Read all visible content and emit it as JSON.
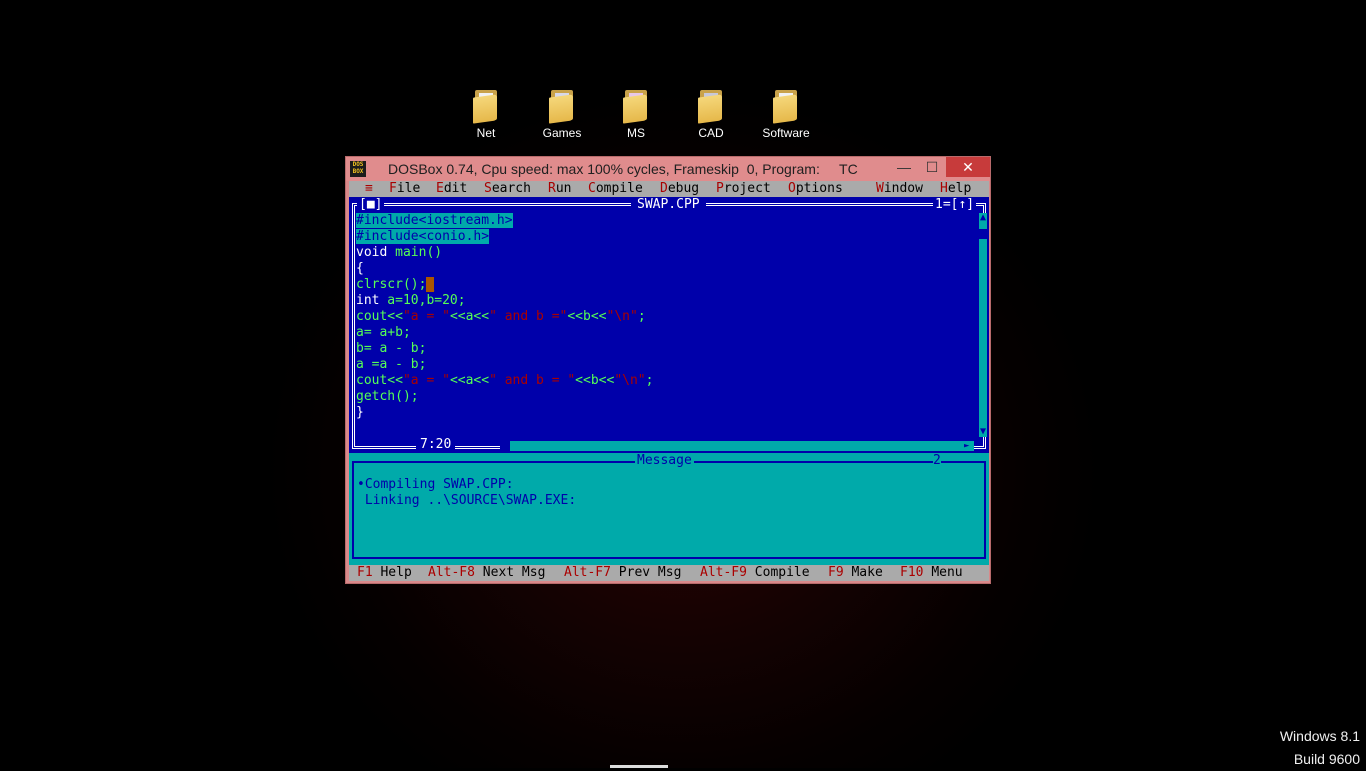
{
  "desktop": {
    "icons": [
      {
        "label": "Net",
        "icon": "folder-icon"
      },
      {
        "label": "Games",
        "icon": "folder-icon"
      },
      {
        "label": "MS",
        "icon": "folder-icon"
      },
      {
        "label": "CAD",
        "icon": "folder-icon"
      },
      {
        "label": "Software",
        "icon": "folder-icon"
      }
    ]
  },
  "window": {
    "title": "DOSBox 0.74, Cpu speed: max 100% cycles, Frameskip  0, Program:     TC",
    "icon_text": "DOS BOX",
    "minimize": "—",
    "maximize": "☐",
    "close": "✕"
  },
  "menu": {
    "system": "≡",
    "items": [
      {
        "hot": "F",
        "rest": "ile"
      },
      {
        "hot": "E",
        "rest": "dit"
      },
      {
        "hot": "S",
        "rest": "earch"
      },
      {
        "hot": "R",
        "rest": "un"
      },
      {
        "hot": "C",
        "rest": "ompile"
      },
      {
        "hot": "D",
        "rest": "ebug"
      },
      {
        "hot": "P",
        "rest": "roject"
      },
      {
        "hot": "O",
        "rest": "ptions"
      },
      {
        "hot": "W",
        "rest": "indow"
      },
      {
        "hot": "H",
        "rest": "elp"
      }
    ]
  },
  "editor": {
    "filename": "SWAP.CPP",
    "close_box": "[■]",
    "window_number": "1=[↑]",
    "cursor_pos": "7:20",
    "lines": [
      {
        "parts": [
          {
            "t": "#include<iostream.h>",
            "c": "sel"
          }
        ]
      },
      {
        "parts": [
          {
            "t": "#include<conio.h>",
            "c": "sel"
          }
        ]
      },
      {
        "parts": [
          {
            "t": "void",
            "c": "kw"
          },
          {
            "t": " main()",
            "c": ""
          }
        ]
      },
      {
        "parts": [
          {
            "t": "{",
            "c": "kw"
          }
        ]
      },
      {
        "parts": [
          {
            "t": "clrscr();",
            "c": ""
          },
          {
            "t": "_",
            "c": "cursor"
          }
        ]
      },
      {
        "parts": [
          {
            "t": "int",
            "c": "kw"
          },
          {
            "t": " a=10,b=20;",
            "c": ""
          }
        ]
      },
      {
        "parts": [
          {
            "t": "cout<<",
            "c": ""
          },
          {
            "t": "\"a = \"",
            "c": "str"
          },
          {
            "t": "<<a<<",
            "c": ""
          },
          {
            "t": "\" and b =\"",
            "c": "str"
          },
          {
            "t": "<<b<<",
            "c": ""
          },
          {
            "t": "\"\\n\"",
            "c": "str"
          },
          {
            "t": ";",
            "c": ""
          }
        ]
      },
      {
        "parts": [
          {
            "t": "a= a+b;",
            "c": ""
          }
        ]
      },
      {
        "parts": [
          {
            "t": "b= a - b;",
            "c": ""
          }
        ]
      },
      {
        "parts": [
          {
            "t": "a =a - b;",
            "c": ""
          }
        ]
      },
      {
        "parts": [
          {
            "t": "cout<<",
            "c": ""
          },
          {
            "t": "\"a = \"",
            "c": "str"
          },
          {
            "t": "<<a<<",
            "c": ""
          },
          {
            "t": "\" and b = \"",
            "c": "str"
          },
          {
            "t": "<<b<<",
            "c": ""
          },
          {
            "t": "\"\\n\"",
            "c": "str"
          },
          {
            "t": ";",
            "c": ""
          }
        ]
      },
      {
        "parts": [
          {
            "t": "getch();",
            "c": ""
          }
        ]
      },
      {
        "parts": [
          {
            "t": "}",
            "c": "kw"
          }
        ]
      }
    ]
  },
  "message": {
    "title": "Message",
    "number": "2",
    "lines": [
      "•Compiling SWAP.CPP:",
      " Linking ..\\SOURCE\\SWAP.EXE:"
    ]
  },
  "status": {
    "keys": [
      {
        "key": "F1",
        "label": "Help"
      },
      {
        "key": "Alt-F8",
        "label": "Next Msg"
      },
      {
        "key": "Alt-F7",
        "label": "Prev Msg"
      },
      {
        "key": "Alt-F9",
        "label": "Compile"
      },
      {
        "key": "F9",
        "label": "Make"
      },
      {
        "key": "F10",
        "label": "Menu"
      }
    ]
  },
  "watermark": {
    "line1": "Windows 8.1",
    "line2": "Build 9600"
  }
}
